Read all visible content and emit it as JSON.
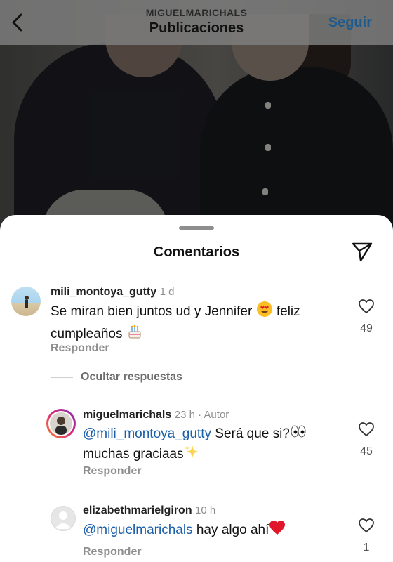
{
  "header": {
    "username": "MIGUELMARICHALS",
    "title": "Publicaciones",
    "follow_label": "Seguir"
  },
  "sheet": {
    "title": "Comentarios"
  },
  "comments": [
    {
      "username": "mili_montoya_gutty",
      "time": "1 d",
      "text_a": "Se miran bien juntos ud y Jennifer",
      "text_b": "feliz",
      "text_c": "cumpleaños",
      "likes": "49",
      "reply_label": "Responder"
    }
  ],
  "hide_replies_label": "Ocultar respuestas",
  "replies": [
    {
      "username": "miguelmarichals",
      "meta": "23 h · Autor",
      "mention": "@mili_montoya_gutty",
      "text_a": "Será que si?",
      "text_b": "muchas graciaas",
      "likes": "45",
      "reply_label": "Responder"
    },
    {
      "username": "elizabethmarielgiron",
      "meta": "10 h",
      "mention": "@miguelmarichals",
      "text_a": "hay algo ahí",
      "likes": "1",
      "reply_label": "Responder"
    }
  ],
  "colors": {
    "mention": "#1b5fa8",
    "follow": "#1e5a8c",
    "heart_emoji": "#e0162b"
  }
}
